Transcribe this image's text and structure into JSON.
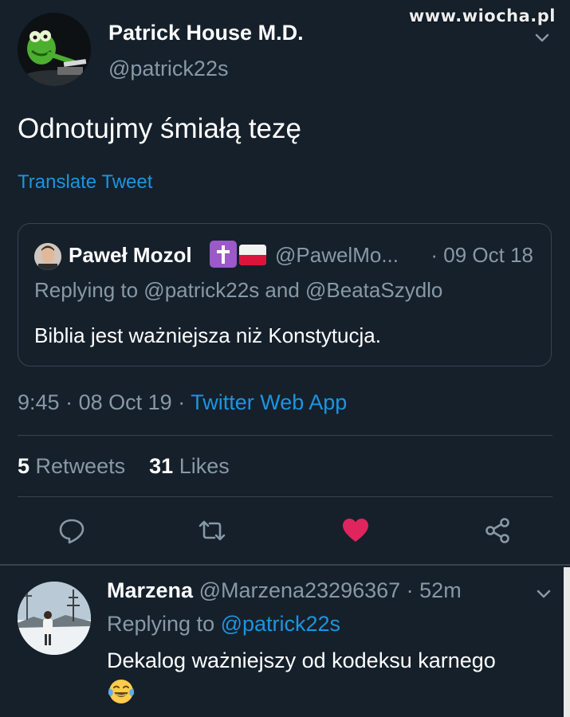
{
  "watermark": "www.wiocha.pl",
  "tweet": {
    "author_name": "Patrick House M.D.",
    "author_handle": "@patrick22s",
    "text": "Odnotujmy śmiałą tezę",
    "translate_label": "Translate Tweet",
    "time": "9:45",
    "date": "08 Oct 19",
    "separator": "·",
    "source": "Twitter Web App",
    "retweets_count": "5",
    "retweets_label": "Retweets",
    "likes_count": "31",
    "likes_label": "Likes",
    "liked": true
  },
  "quoted": {
    "author_name": "Paweł Mozol",
    "badges": [
      "cross-emoji",
      "poland-flag-emoji"
    ],
    "author_handle": "@PawelMo...",
    "date": "· 09 Oct 18",
    "replying": "Replying to @patrick22s and @BeataSzydlo",
    "text": "Biblia jest ważniejsza niż Konstytucja."
  },
  "reply": {
    "author_name": "Marzena",
    "author_handle": "@Marzena23296367",
    "time": "· 52m",
    "replying_prefix": "Replying to ",
    "replying_mention": "@patrick22s",
    "text": "Dekalog ważniejszy od kodeksu karnego",
    "emoji": "tears-of-joy-emoji"
  },
  "icons": {
    "reply": "comment-icon",
    "retweet": "retweet-icon",
    "like": "heart-icon",
    "share": "share-icon"
  },
  "colors": {
    "background": "#15202b",
    "accent": "#1b95e0",
    "secondary_text": "#8899a6",
    "like_active": "#e0245e",
    "border": "#38444d"
  }
}
